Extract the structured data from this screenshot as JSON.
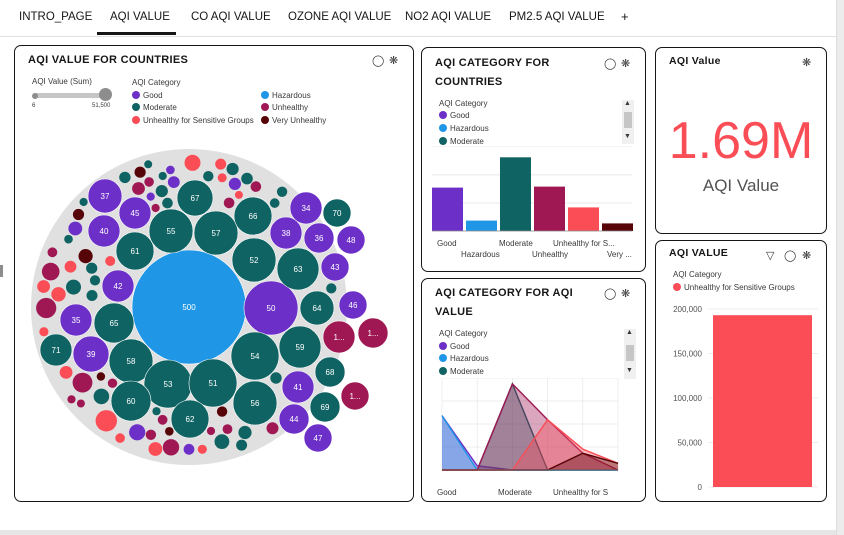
{
  "tabs": [
    {
      "label": "INTRO_PAGE"
    },
    {
      "label": "AQI VALUE"
    },
    {
      "label": "CO AQI VALUE"
    },
    {
      "label": "OZONE AQI VALUE"
    },
    {
      "label": "NO2 AQI VALUE"
    },
    {
      "label": "PM2.5 AQI VALUE"
    },
    {
      "label": "+"
    }
  ],
  "colors": {
    "good": "#6c2fc7",
    "hazardous": "#1f96e6",
    "moderate": "#0f6363",
    "unhealthy": "#9f1853",
    "sensitive": "#fa4d56",
    "very_unhealthy": "#570408",
    "kpi": "#fa4d56"
  },
  "bubble": {
    "title": "AQI VALUE FOR COUNTRIES",
    "size_legend_title": "AQI Value (Sum)",
    "size_min": "6",
    "size_max": "51,500",
    "category_title": "AQI Category",
    "categories": [
      {
        "label": "Good",
        "color": "#6c2fc7"
      },
      {
        "label": "Hazardous",
        "color": "#1f96e6"
      },
      {
        "label": "Moderate",
        "color": "#0f6363"
      },
      {
        "label": "Unhealthy",
        "color": "#9f1853"
      },
      {
        "label": "Unhealthy for Sensitive Groups",
        "color": "#fa4d56"
      },
      {
        "label": "Very Unhealthy",
        "color": "#570408"
      }
    ],
    "labels": [
      "500",
      "50",
      "37",
      "45",
      "40",
      "61",
      "42",
      "35",
      "65",
      "71",
      "39",
      "58",
      "67",
      "55",
      "57",
      "66",
      "52",
      "38",
      "34",
      "70",
      "36",
      "48",
      "63",
      "43",
      "46",
      "64",
      "1...",
      "1...",
      "59",
      "54",
      "68",
      "53",
      "51",
      "60",
      "62",
      "56",
      "41",
      "44",
      "69",
      "47",
      "1..."
    ]
  },
  "cat_countries": {
    "title_line1": "AQI CATEGORY FOR",
    "title_line2": "COUNTRIES",
    "legend_title": "AQI Category",
    "legend": [
      {
        "label": "Good",
        "color": "#6c2fc7"
      },
      {
        "label": "Hazardous",
        "color": "#1f96e6"
      },
      {
        "label": "Moderate",
        "color": "#0f6363"
      }
    ],
    "x_top": [
      "Good",
      "Moderate",
      "Unhealthy for S..."
    ],
    "x_bottom": [
      "Hazardous",
      "Unhealthy",
      "Very ..."
    ]
  },
  "kpi": {
    "title": "AQI Value",
    "value": "1.69M",
    "caption": "AQI Value"
  },
  "cat_value": {
    "title_line1": "AQI CATEGORY FOR AQI",
    "title_line2": "VALUE",
    "legend_title": "AQI Category",
    "legend": [
      {
        "label": "Good",
        "color": "#6c2fc7"
      },
      {
        "label": "Hazardous",
        "color": "#1f96e6"
      },
      {
        "label": "Moderate",
        "color": "#0f6363"
      }
    ],
    "x_labels": [
      "Good",
      "Moderate",
      "Unhealthy for S"
    ]
  },
  "aqi_value_chart": {
    "title": "AQI VALUE",
    "legend_title": "AQI Category",
    "legend_label": "Unhealthy for Sensitive Groups"
  },
  "chart_data": [
    {
      "type": "bar",
      "title": "AQI CATEGORY FOR COUNTRIES",
      "categories": [
        "Good",
        "Hazardous",
        "Moderate",
        "Unhealthy",
        "Unhealthy for S...",
        "Very ..."
      ],
      "values": [
        46,
        11,
        78,
        47,
        25,
        8
      ],
      "colors": [
        "#6c2fc7",
        "#1f96e6",
        "#0f6363",
        "#9f1853",
        "#fa4d56",
        "#570408"
      ],
      "grid": true
    },
    {
      "type": "area",
      "title": "AQI CATEGORY FOR AQI VALUE",
      "categories": [
        "Good",
        "Hazardous",
        "Moderate",
        "Unhealthy",
        "Unhealthy for S",
        "Very Unhealthy"
      ],
      "series": [
        {
          "name": "Good",
          "color": "#6c2fc7",
          "values": [
            65,
            5,
            0,
            0,
            0,
            0
          ]
        },
        {
          "name": "Hazardous",
          "color": "#1f96e6",
          "values": [
            65,
            0,
            0,
            0,
            0,
            0
          ]
        },
        {
          "name": "Moderate",
          "color": "#0f6363",
          "values": [
            0,
            0,
            103,
            0,
            0,
            0
          ]
        },
        {
          "name": "Unhealthy",
          "color": "#9f1853",
          "values": [
            0,
            0,
            103,
            60,
            20,
            0
          ]
        },
        {
          "name": "Unhealthy for Sensitive Groups",
          "color": "#fa4d56",
          "values": [
            0,
            0,
            0,
            60,
            25,
            8
          ]
        },
        {
          "name": "Very Unhealthy",
          "color": "#570408",
          "values": [
            0,
            0,
            0,
            0,
            20,
            8
          ]
        }
      ],
      "grid": true
    },
    {
      "type": "bar",
      "title": "AQI VALUE",
      "categories": [
        "Unhealthy for Sensitive Groups"
      ],
      "values": [
        193000
      ],
      "ylim": [
        0,
        200000
      ],
      "yticks": [
        "0",
        "50,000",
        "100,000",
        "150,000",
        "200,000"
      ],
      "grid": true
    }
  ]
}
